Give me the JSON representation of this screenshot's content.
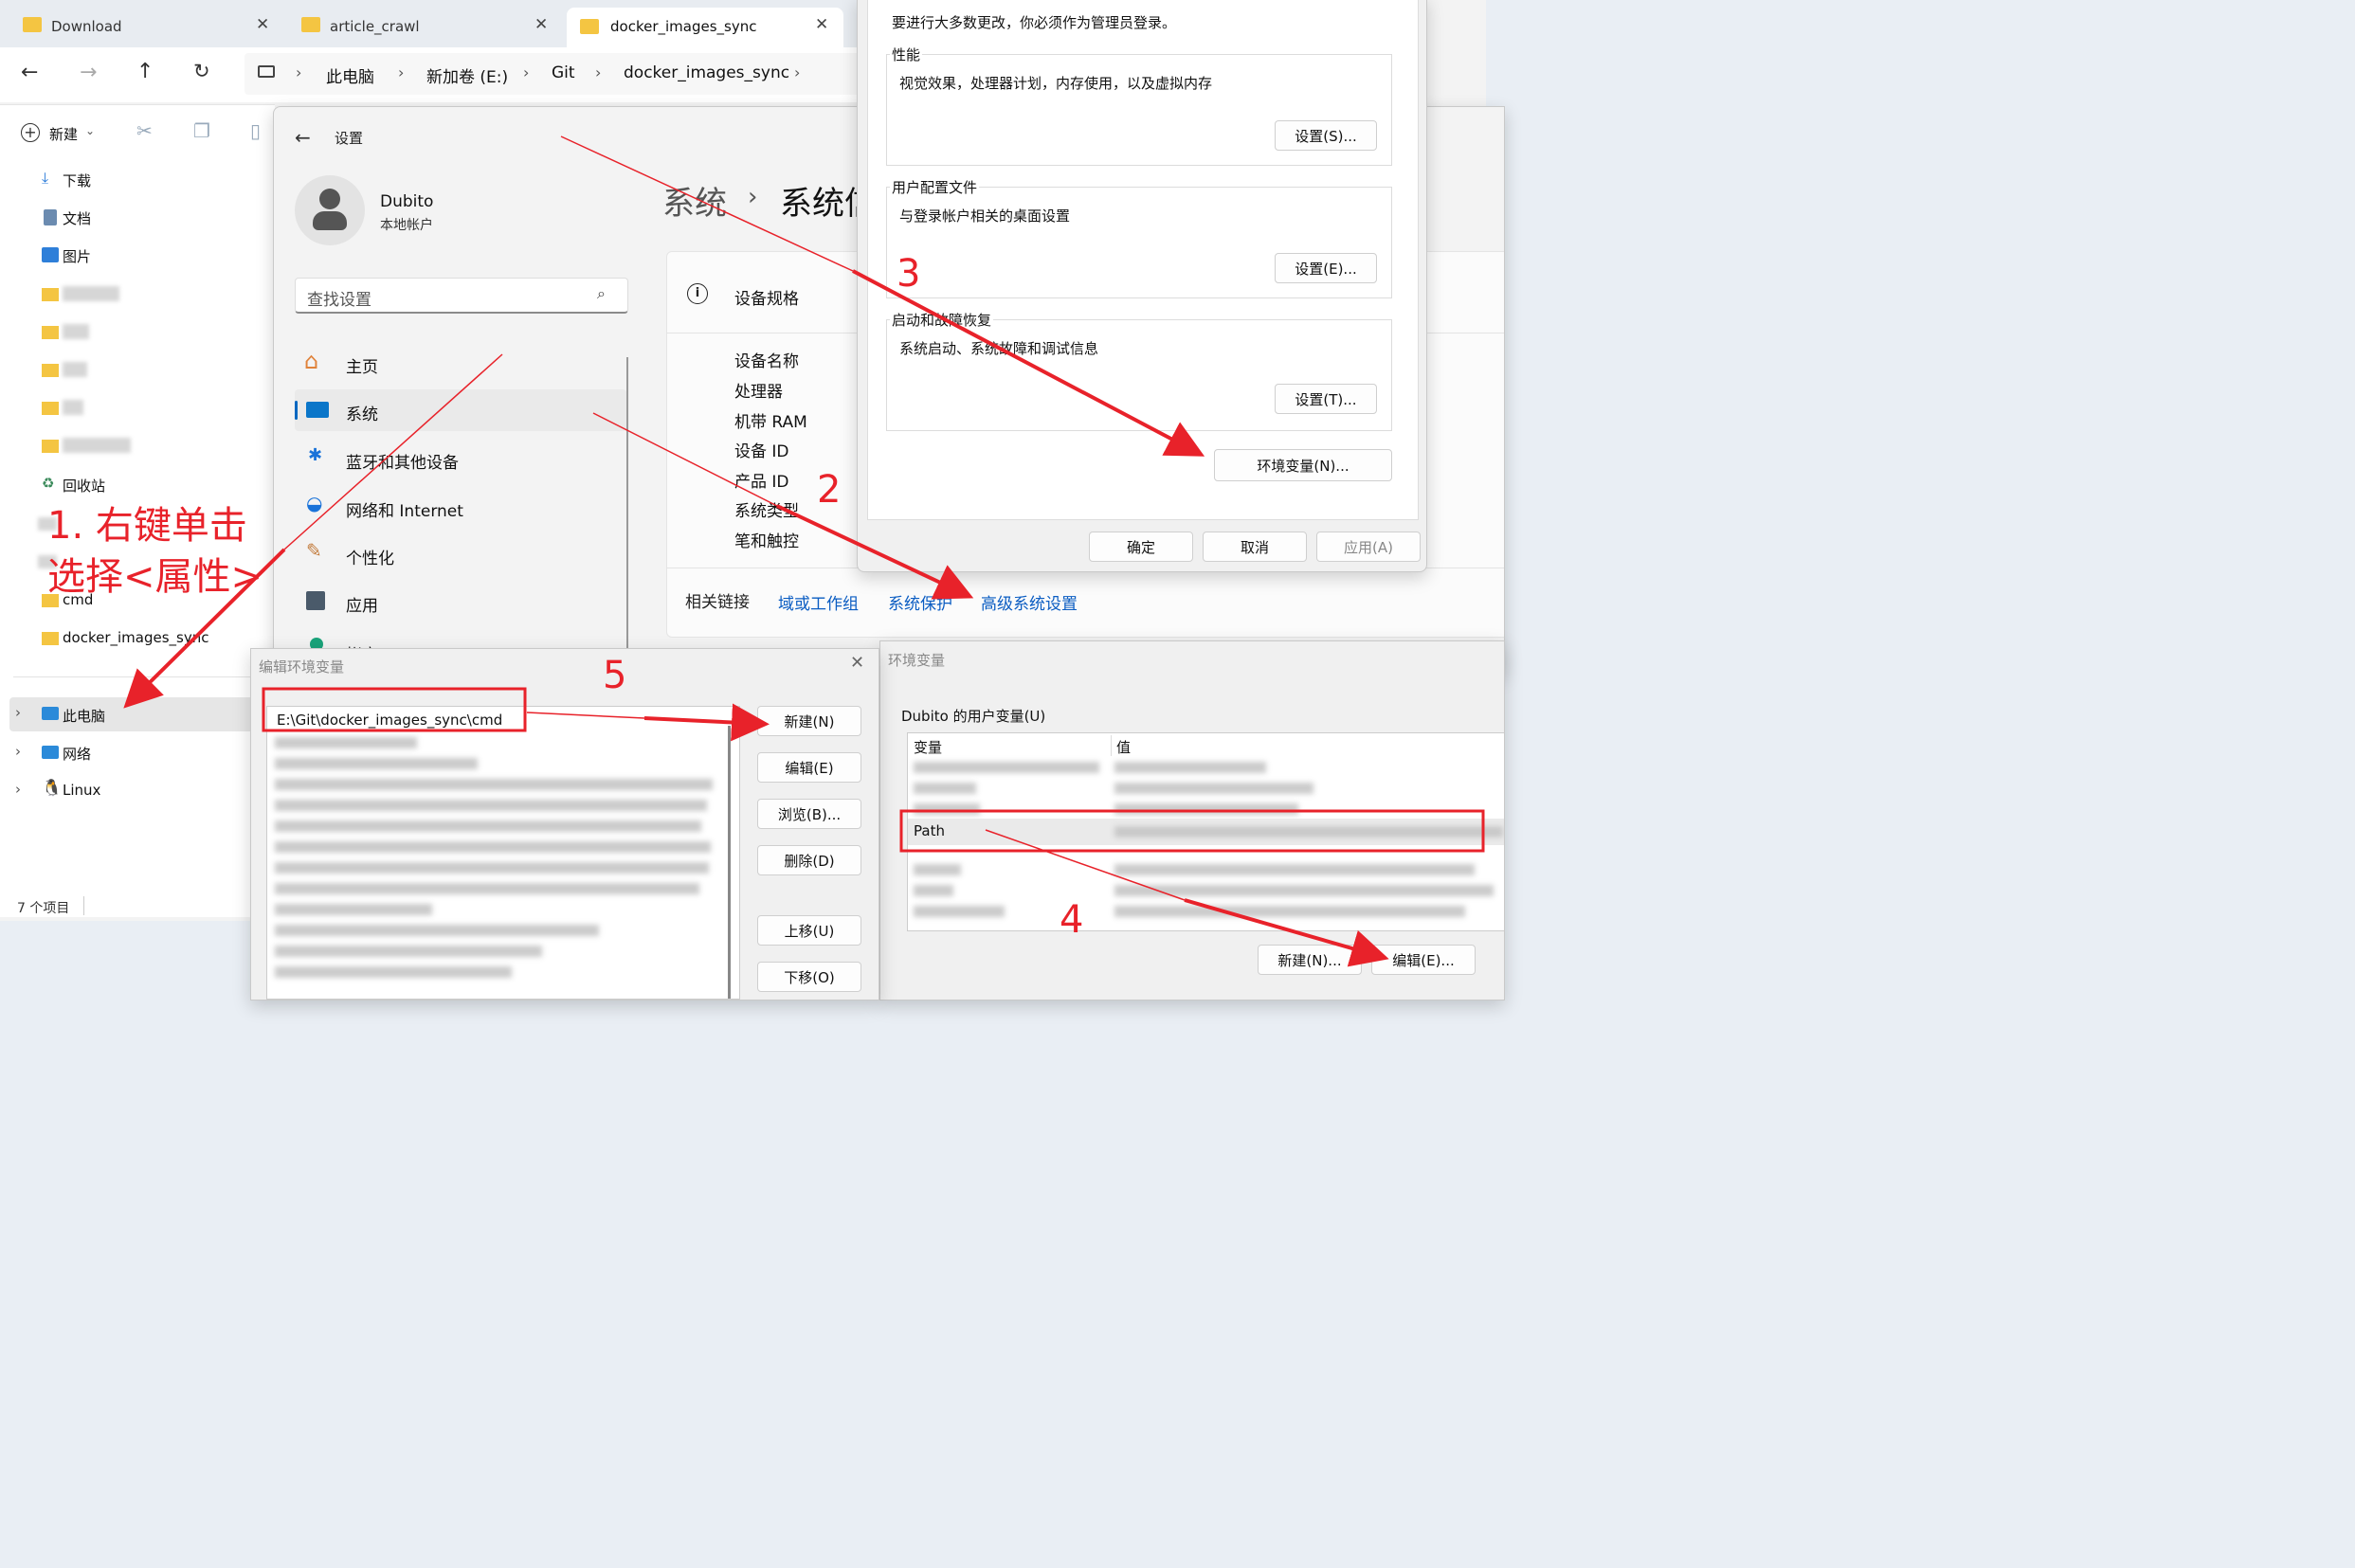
{
  "explorer": {
    "tabs": [
      {
        "label": "Download"
      },
      {
        "label": "article_crawl"
      },
      {
        "label": "docker_images_sync"
      }
    ],
    "breadcrumb": [
      "此电脑",
      "新加卷 (E:)",
      "Git",
      "docker_images_sync"
    ],
    "new_label": "新建",
    "sidebar": [
      {
        "label": "下载"
      },
      {
        "label": "文档"
      },
      {
        "label": "图片"
      },
      {
        "label": "回收站"
      },
      {
        "label": "cmd"
      },
      {
        "label": "docker_images_sync"
      },
      {
        "label": "此电脑"
      },
      {
        "label": "网络"
      },
      {
        "label": "Linux"
      }
    ],
    "status": "7 个项目"
  },
  "settings": {
    "back_title": "设置",
    "user_name": "Dubito",
    "user_type": "本地帐户",
    "search_placeholder": "查找设置",
    "nav": [
      {
        "label": "主页"
      },
      {
        "label": "系统"
      },
      {
        "label": "蓝牙和其他设备"
      },
      {
        "label": "网络和 Internet"
      },
      {
        "label": "个性化"
      },
      {
        "label": "应用"
      },
      {
        "label": "帐户"
      }
    ],
    "heading_parent": "系统",
    "heading_current": "系统信",
    "section_title": "设备规格",
    "specs": [
      "设备名称",
      "处理器",
      "机带 RAM",
      "设备 ID",
      "产品 ID",
      "系统类型",
      "笔和触控"
    ],
    "related_label": "相关链接",
    "related_links": [
      "域或工作组",
      "系统保护",
      "高级系统设置"
    ]
  },
  "sysprops": {
    "top_note": "要进行大多数更改，你必须作为管理员登录。",
    "perf_title": "性能",
    "perf_desc": "视觉效果，处理器计划，内存使用，以及虚拟内存",
    "perf_btn": "设置(S)...",
    "profile_title": "用户配置文件",
    "profile_desc": "与登录帐户相关的桌面设置",
    "profile_btn": "设置(E)...",
    "startup_title": "启动和故障恢复",
    "startup_desc": "系统启动、系统故障和调试信息",
    "startup_btn": "设置(T)...",
    "env_btn": "环境变量(N)...",
    "ok": "确定",
    "cancel": "取消",
    "apply": "应用(A)"
  },
  "envvars": {
    "title": "环境变量",
    "user_section": "Dubito 的用户变量(U)",
    "col_var": "变量",
    "col_val": "值",
    "path_name": "Path",
    "new_btn": "新建(N)...",
    "edit_btn": "编辑(E)..."
  },
  "editenv": {
    "title": "编辑环境变量",
    "first_entry": "E:\\Git\\docker_images_sync\\cmd",
    "buttons": [
      "新建(N)",
      "编辑(E)",
      "浏览(B)...",
      "删除(D)",
      "上移(U)",
      "下移(O)"
    ]
  },
  "annotations": {
    "step1_line1": "1. 右键单击",
    "step1_line2": "选择<属性>",
    "step2": "2",
    "step3": "3",
    "step4": "4",
    "step5": "5"
  },
  "colors": {
    "accent": "#0067c0",
    "annotation": "#e8222a",
    "link": "#0a5cc2"
  }
}
